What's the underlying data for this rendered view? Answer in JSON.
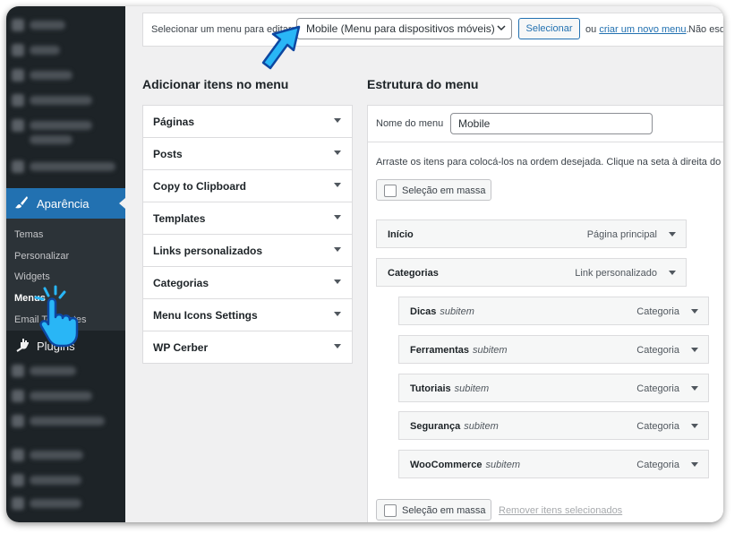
{
  "sidebar": {
    "active_label": "Aparência",
    "submenu": [
      "Temas",
      "Personalizar",
      "Widgets",
      "Menus",
      "Email Templates"
    ],
    "current_submenu": "Menus",
    "plugins_label": "Plugins"
  },
  "topbar": {
    "select_label": "Selecionar um menu para editar:",
    "selected_menu": "Mobile (Menu para dispositivos móveis)",
    "select_button": "Selecionar",
    "or_text": "ou",
    "create_link": "criar um novo menu",
    "not_text": "Não esq"
  },
  "add_items": {
    "heading": "Adicionar itens no menu",
    "sections": [
      "Páginas",
      "Posts",
      "Copy to Clipboard",
      "Templates",
      "Links personalizados",
      "Categorias",
      "Menu Icons Settings",
      "WP Cerber"
    ]
  },
  "structure": {
    "heading": "Estrutura do menu",
    "name_label": "Nome do menu",
    "name_value": "Mobile",
    "hint": "Arraste os itens para colocá-los na ordem desejada. Clique na seta à direita do ite",
    "bulk_label": "Seleção em massa",
    "remove_label": "Remover itens selecionados",
    "items": [
      {
        "title": "Início",
        "sub": "",
        "type": "Página principal"
      },
      {
        "title": "Categorias",
        "sub": "",
        "type": "Link personalizado"
      },
      {
        "title": "Dicas",
        "sub": "subitem",
        "type": "Categoria"
      },
      {
        "title": "Ferramentas",
        "sub": "subitem",
        "type": "Categoria"
      },
      {
        "title": "Tutoriais",
        "sub": "subitem",
        "type": "Categoria"
      },
      {
        "title": "Segurança",
        "sub": "subitem",
        "type": "Categoria"
      },
      {
        "title": "WooCommerce",
        "sub": "subitem",
        "type": "Categoria"
      }
    ]
  },
  "colors": {
    "accent": "#2271b1",
    "sidebar": "#1d2327",
    "pointer": "#29b6f6"
  }
}
